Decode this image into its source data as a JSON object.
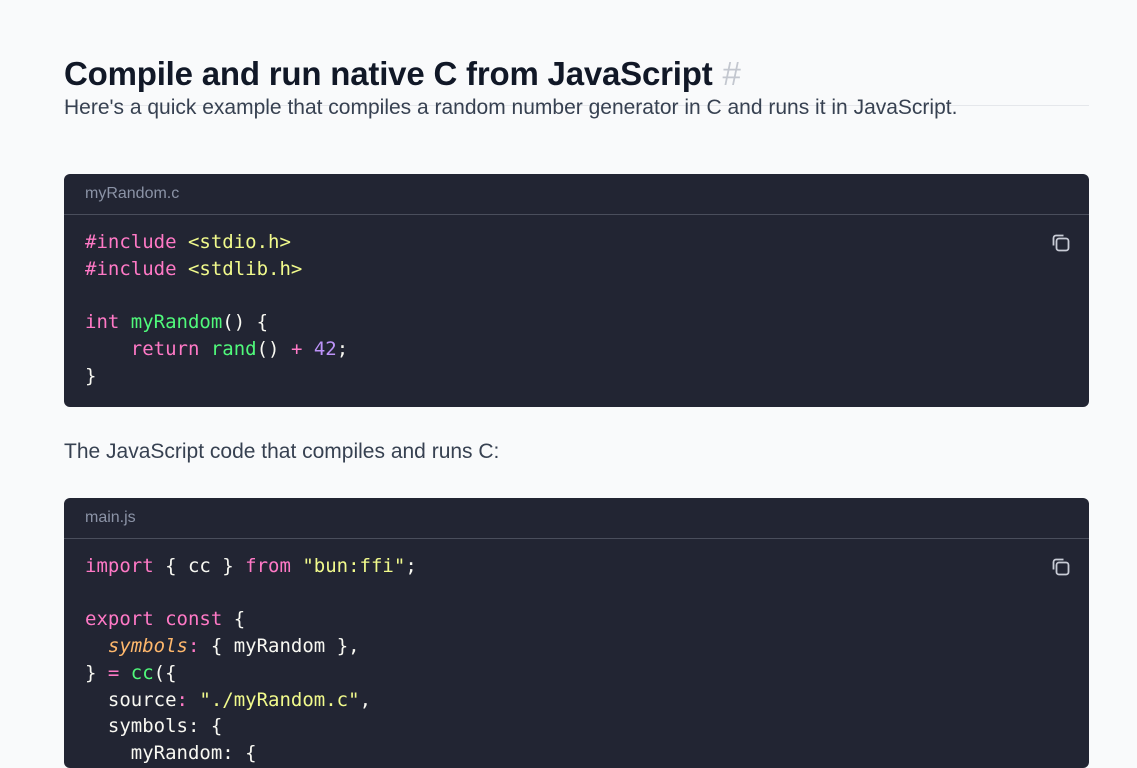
{
  "heading": {
    "title": "Compile and run native C from JavaScript",
    "anchor": "#"
  },
  "intro": "Here's a quick example that compiles a random number generator in C and runs it in JavaScript.",
  "block1": {
    "filename": "myRandom.c",
    "lines": [
      [
        [
          "kw",
          "#include "
        ],
        [
          "str",
          "<stdio.h>"
        ]
      ],
      [
        [
          "kw",
          "#include "
        ],
        [
          "str",
          "<stdlib.h>"
        ]
      ],
      [],
      [
        [
          "kw",
          "int "
        ],
        [
          "fn",
          "myRandom"
        ],
        [
          "",
          "() {"
        ]
      ],
      [
        [
          "",
          "    "
        ],
        [
          "kw",
          "return "
        ],
        [
          "fn",
          "rand"
        ],
        [
          "",
          "() "
        ],
        [
          "kw",
          "+ "
        ],
        [
          "num",
          "42"
        ],
        [
          "",
          ";"
        ]
      ],
      [
        [
          "",
          "}"
        ]
      ]
    ]
  },
  "middle": "The JavaScript code that compiles and runs C:",
  "block2": {
    "filename": "main.js",
    "lines": [
      [
        [
          "kw",
          "import "
        ],
        [
          "",
          "{ cc } "
        ],
        [
          "kw",
          "from "
        ],
        [
          "str",
          "\"bun:ffi\""
        ],
        [
          "",
          ";"
        ]
      ],
      [],
      [
        [
          "kw",
          "export const "
        ],
        [
          "",
          "{"
        ]
      ],
      [
        [
          "",
          "  "
        ],
        [
          "prop",
          "symbols"
        ],
        [
          "kw",
          ": "
        ],
        [
          "",
          "{ myRandom },"
        ]
      ],
      [
        [
          "",
          "} "
        ],
        [
          "kw",
          "= "
        ],
        [
          "fn",
          "cc"
        ],
        [
          "",
          "({"
        ]
      ],
      [
        [
          "",
          "  source"
        ],
        [
          "kw",
          ": "
        ],
        [
          "str",
          "\"./myRandom.c\""
        ],
        [
          "",
          ","
        ]
      ],
      [
        [
          "",
          "  symbols: {"
        ]
      ],
      [
        [
          "",
          "    myRandom: {"
        ]
      ]
    ]
  },
  "icons": {
    "copy": "copy-icon"
  }
}
